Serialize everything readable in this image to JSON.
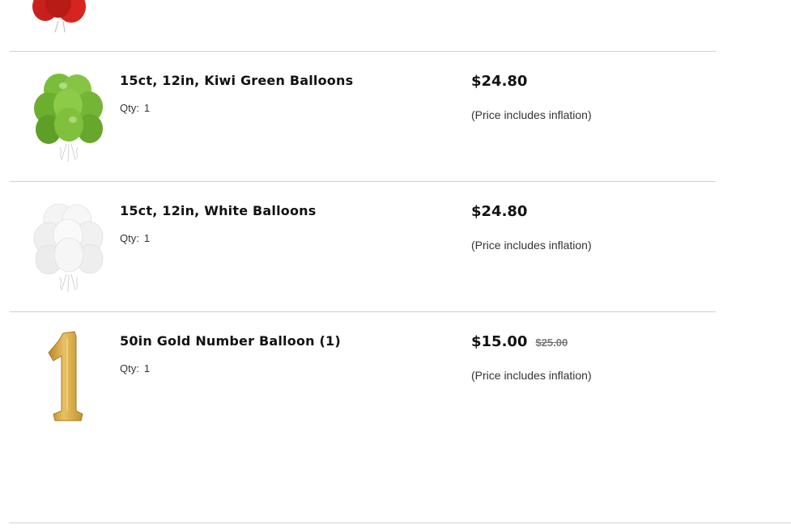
{
  "cart": {
    "partial_item": {
      "image_icon": "red-balloons-icon"
    },
    "items": [
      {
        "name": "15ct, 12in, Kiwi Green Balloons",
        "qty_label": "Qty:",
        "qty": "1",
        "price": "$24.80",
        "original_price": "",
        "note": "(Price includes inflation)",
        "image_icon": "green-balloons-icon",
        "color": "#7bbd3a"
      },
      {
        "name": "15ct, 12in, White Balloons",
        "qty_label": "Qty:",
        "qty": "1",
        "price": "$24.80",
        "original_price": "",
        "note": "(Price includes inflation)",
        "image_icon": "white-balloons-icon",
        "color": "#f2f2f2"
      },
      {
        "name": "50in Gold Number Balloon (1)",
        "qty_label": "Qty:",
        "qty": "1",
        "price": "$15.00",
        "original_price": "$25.00",
        "note": "(Price includes inflation)",
        "image_icon": "gold-number-one-balloon-icon",
        "color": "#d4a43a"
      }
    ]
  }
}
